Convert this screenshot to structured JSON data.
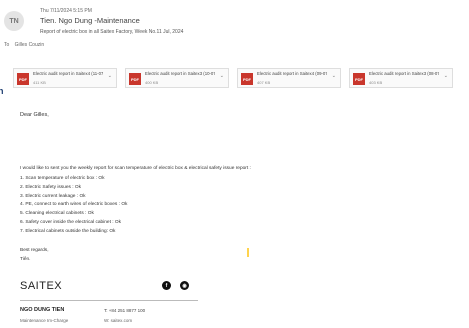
{
  "header": {
    "avatar_initials": "TN",
    "date": "Thu 7/11/2024 5:15 PM",
    "sender": "Tien. Ngo Dung -Maintenance",
    "subject": "Report of electric box in all Saitex Factory, Week No.11 Jul, 2024",
    "to_label": "To",
    "to_value": "Gilles Couzin"
  },
  "left_edge_fragment": "n",
  "attachments": [
    {
      "name": "Electric audit report in Saitex4 (11-07-2024).pdf",
      "size": "411 KB",
      "icon_label": "PDF"
    },
    {
      "name": "Electric audit report in Saitex3 (10-07-2024).pdf",
      "size": "400 KB",
      "icon_label": "PDF"
    },
    {
      "name": "Electric audit report in Saitex4 (09-07-2024).pdf",
      "size": "407 KB",
      "icon_label": "PDF"
    },
    {
      "name": "Electric audit report in Saitex3 (08-07-2024).pdf",
      "size": "403 KB",
      "icon_label": "PDF"
    }
  ],
  "body": {
    "greeting": "Dear Gilles,",
    "intro": "I would like to sent you the weekly report for scan temperature of electric box & electrical safety issue report :",
    "items": [
      "1. Scan temperature of electric box : Ok",
      "2. Electric Safety issues : Ok",
      "3. Electric current leakage : Ok",
      "4. PE, connect to earth wires of electric boxes : Ok",
      "5. Cleaning electrical cabinets : Ok",
      "6. Safety cover inside the electrical cabinet : Ok",
      "7. Electrical cabinets outside the building: Ok"
    ],
    "closing": "Best regards,",
    "signoff": "Tiên."
  },
  "signature": {
    "logo": "SAITEX",
    "name": "NGO DUNG TIEN",
    "role": "Maintenance Im-Charge",
    "phone": "T: +84 251 8877 100",
    "website": "W: saitex.com",
    "social": [
      {
        "icon": "facebook-icon",
        "glyph": "f"
      },
      {
        "icon": "instagram-icon",
        "glyph": "◉"
      }
    ]
  },
  "colors": {
    "pdf_red": "#c9362c",
    "left_edge_text": "#1e3e72",
    "cursor": "#ffd34d"
  }
}
